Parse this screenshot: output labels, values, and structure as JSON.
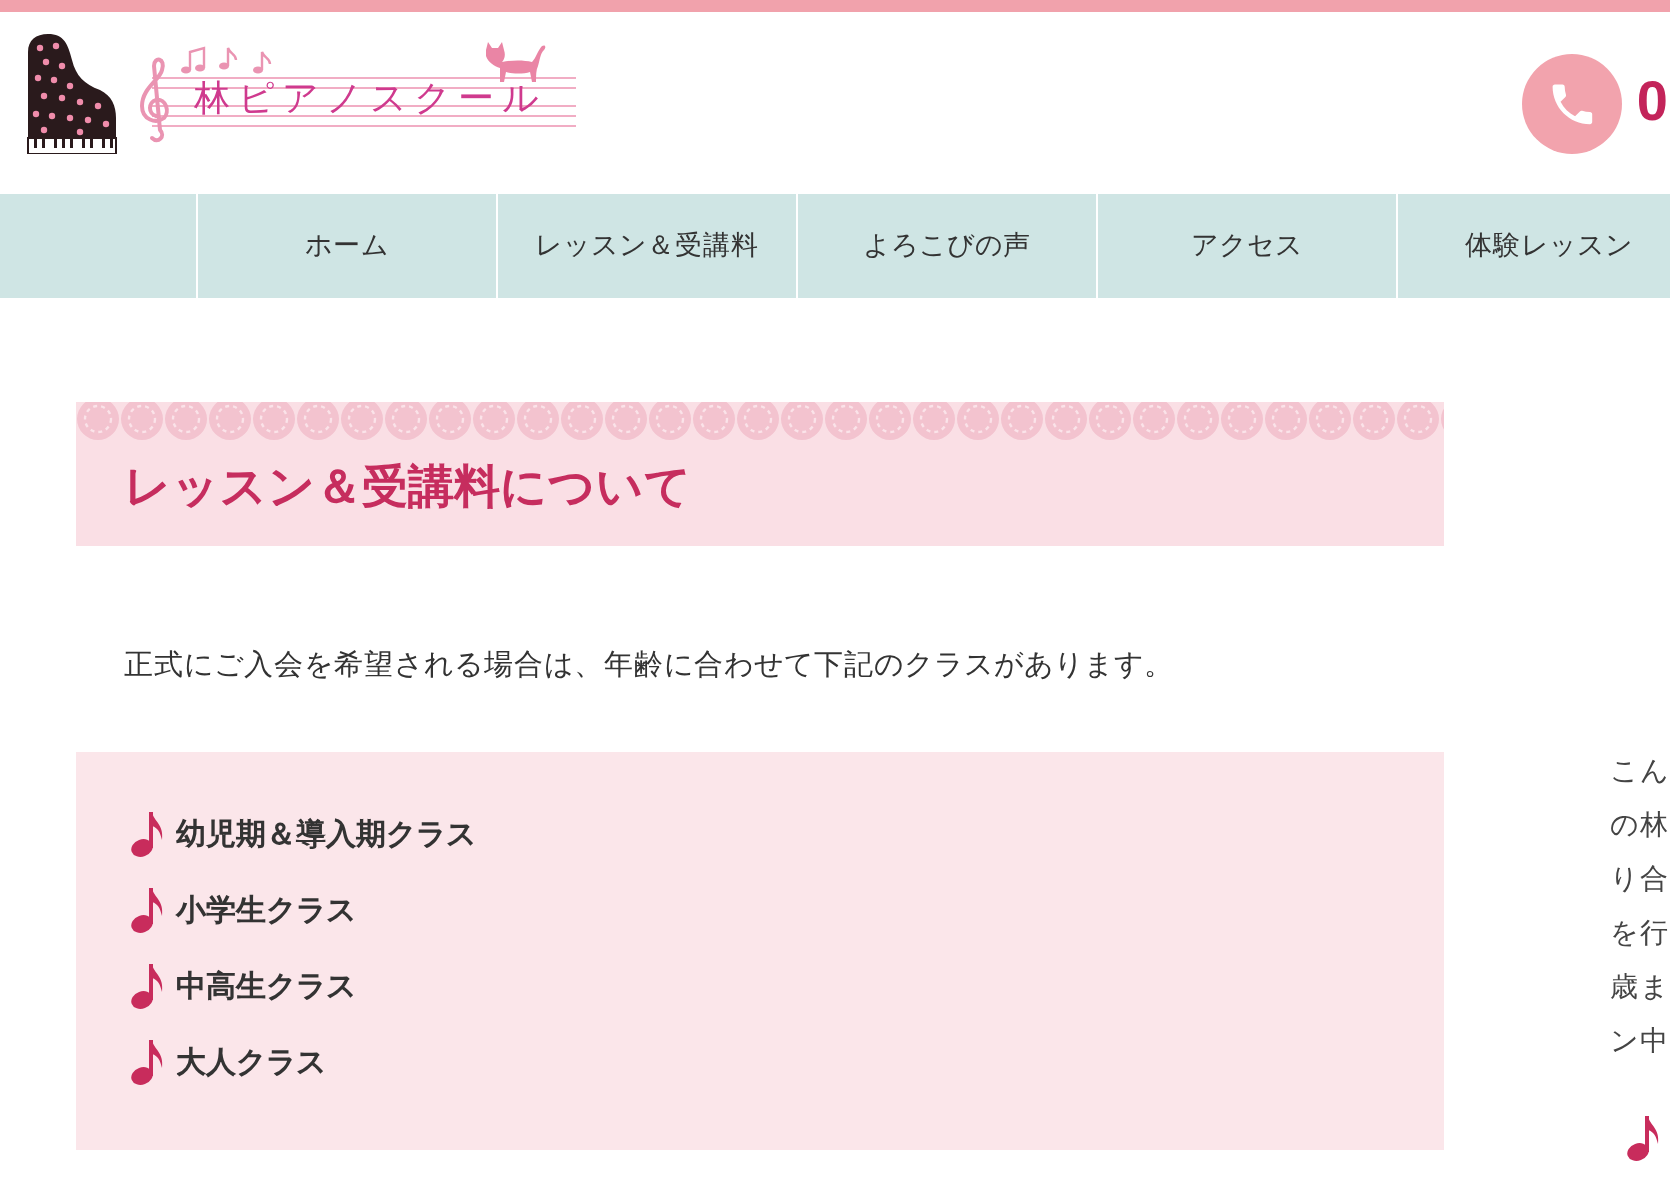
{
  "header": {
    "logo_text": "林ピアノスクール",
    "phone_number": "0"
  },
  "nav": {
    "items": [
      "ホーム",
      "レッスン＆受講料",
      "よろこびの声",
      "アクセス",
      "体験レッスン"
    ]
  },
  "section": {
    "title": "レッスン＆受講料について",
    "intro": "正式にご入会を希望される場合は、年齢に合わせて下記のクラスがあります。",
    "classes": [
      "幼児期＆導入期クラス",
      "小学生クラス",
      "中高生クラス",
      "大人クラス"
    ]
  },
  "sidebar": {
    "lines": [
      "こん",
      "の林",
      "り合",
      "を行",
      "歳ま",
      "ン中"
    ]
  }
}
